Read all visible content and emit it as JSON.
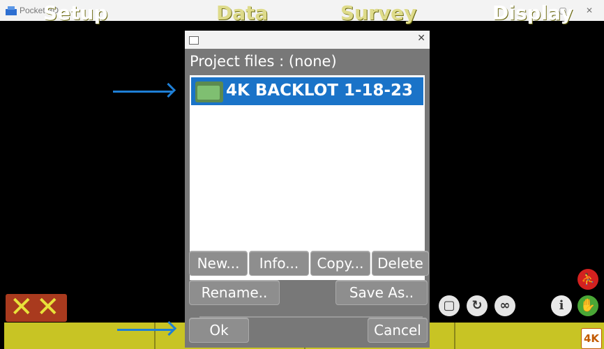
{
  "window": {
    "title": "Pocket-3D",
    "minimize": "—",
    "maximize": "▢",
    "close": "✕"
  },
  "dialog": {
    "close": "✕",
    "header": "Project files : (none)",
    "files": [
      {
        "name": "4K BACKLOT 1-18-23",
        "selected": true
      }
    ],
    "buttons": {
      "new": "New...",
      "info": "Info...",
      "copy": "Copy...",
      "delete": "Delete",
      "rename": "Rename..",
      "save_as": "Save As..",
      "ok": "Ok",
      "cancel": "Cancel"
    }
  },
  "bottom_tabs": {
    "setup": "Setup",
    "data": "Data",
    "survey": "Survey",
    "display": "Display"
  },
  "logo": "4K",
  "icons": {
    "square": "▢",
    "rotate": "↻",
    "loop": "∞",
    "info": "i",
    "hand": "✋",
    "person": "⛹"
  },
  "colors": {
    "selection": "#1a73c8",
    "toolbar": "#c8c424",
    "arrow": "#1e7fd6"
  }
}
